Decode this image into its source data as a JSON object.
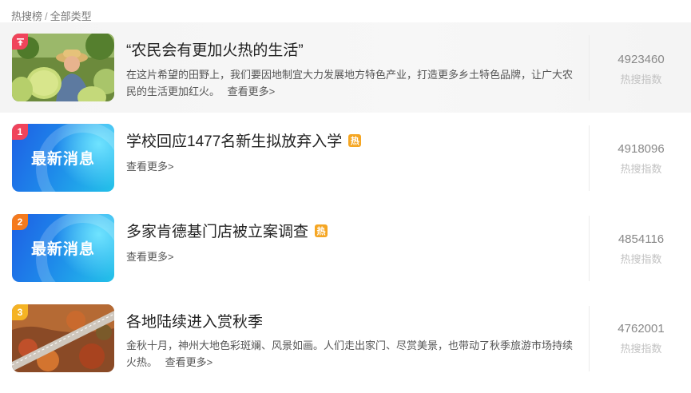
{
  "breadcrumb": {
    "root": "热搜榜",
    "separator": "/",
    "current": "全部类型"
  },
  "colors": {
    "rank_top": "#f0445b",
    "rank_1": "#f0445b",
    "rank_2": "#f57a1d",
    "rank_3": "#f5b324",
    "hot_badge": "#f5a623"
  },
  "items": [
    {
      "rank": "顶",
      "rank_icon": "pin-top-icon",
      "title": "“农民会有更加火热的生活”",
      "description": "在这片希望的田野上，我们要因地制宜大力发展地方特色产业，打造更多乡土特色品牌，让广大农民的生活更加红火。",
      "more": "查看更多>",
      "count": "4923460",
      "count_label": "热搜指数",
      "thumb": "farmer-with-pomelos"
    },
    {
      "rank": "1",
      "title": "学校回应1477名新生拟放弃入学",
      "hot": "热",
      "more": "查看更多>",
      "count": "4918096",
      "count_label": "热搜指数",
      "thumb_text": "最新消息"
    },
    {
      "rank": "2",
      "title": "多家肯德基门店被立案调查",
      "hot": "热",
      "more": "查看更多>",
      "count": "4854116",
      "count_label": "热搜指数",
      "thumb_text": "最新消息"
    },
    {
      "rank": "3",
      "title": "各地陆续进入赏秋季",
      "description": "金秋十月，神州大地色彩斑斓、风景如画。人们走出家门、尽赏美景，也带动了秋季旅游市场持续火热。",
      "more": "查看更多>",
      "count": "4762001",
      "count_label": "热搜指数",
      "thumb": "autumn-mountain-road"
    }
  ]
}
